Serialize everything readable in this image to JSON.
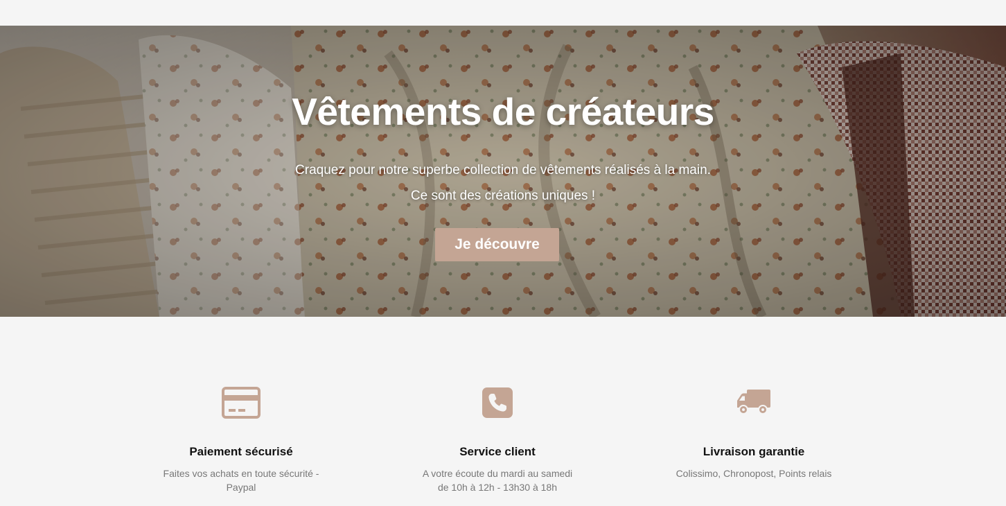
{
  "hero": {
    "title": "Vêtements de créateurs",
    "line1": "Craquez pour notre superbe collection de vêtements réalisés à la main.",
    "line2": "Ce sont des créations uniques !",
    "button_label": "Je découvre"
  },
  "features": [
    {
      "icon": "credit-card-icon",
      "title": "Paiement sécurisé",
      "desc_line1": "Faites vos achats en toute sécurité -",
      "desc_line2": "Paypal"
    },
    {
      "icon": "phone-icon",
      "title": "Service client",
      "desc_line1": "A votre écoute du mardi au samedi",
      "desc_line2": "de 10h à 12h - 13h30 à 18h"
    },
    {
      "icon": "truck-icon",
      "title": "Livraison garantie",
      "desc_line1": "Colissimo, Chronopost, Points relais",
      "desc_line2": ""
    }
  ],
  "colors": {
    "accent": "#c4a594",
    "background": "#f5f5f5",
    "title_text": "#111111",
    "muted_text": "#777777"
  }
}
